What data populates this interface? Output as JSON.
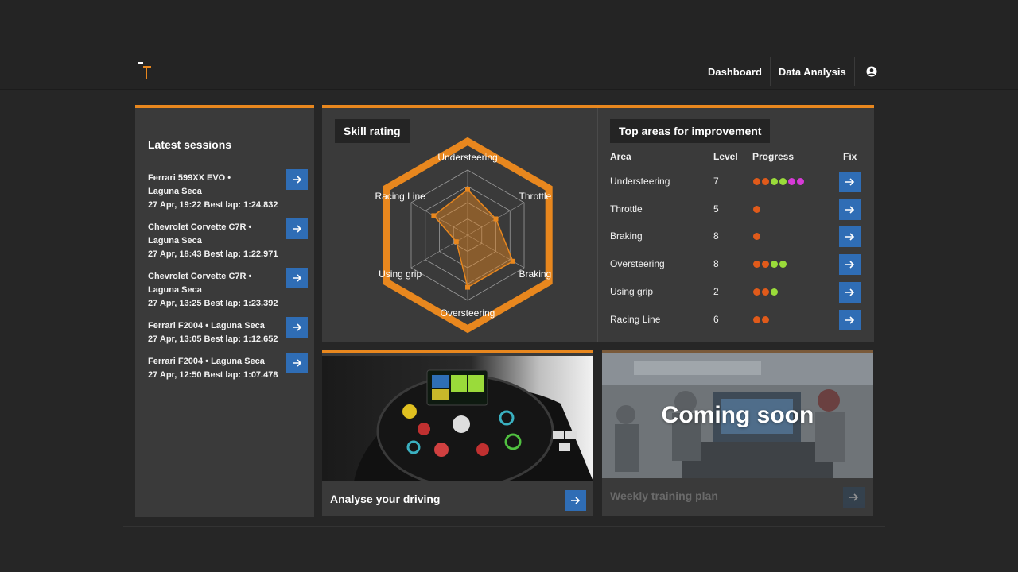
{
  "nav": {
    "dashboard": "Dashboard",
    "data_analysis": "Data Analysis",
    "user_icon": "user-circle-icon"
  },
  "colors": {
    "accent": "#e8871e",
    "button": "#2f6db5",
    "panel": "#3a3a3a",
    "background": "#262626"
  },
  "sessions": {
    "title": "Latest sessions",
    "items": [
      {
        "line1": "Ferrari 599XX EVO  •",
        "line2": "Laguna Seca",
        "line3": "27 Apr, 19:22 Best lap: 1:24.832"
      },
      {
        "line1": "Chevrolet Corvette C7R  •",
        "line2": "Laguna Seca",
        "line3": "27 Apr, 18:43 Best lap: 1:22.971"
      },
      {
        "line1": "Chevrolet Corvette C7R  •",
        "line2": "Laguna Seca",
        "line3": "27 Apr, 13:25 Best lap: 1:23.392"
      },
      {
        "line1": "Ferrari F2004  •  Laguna Seca",
        "line2": "27 Apr, 13:05 Best lap: 1:12.652"
      },
      {
        "line1": "Ferrari F2004  •  Laguna Seca",
        "line2": "27 Apr, 12:50 Best lap: 1:07.478"
      }
    ]
  },
  "skill": {
    "title": "Skill rating",
    "axes": [
      "Understeering",
      "Throttle",
      "Braking",
      "Oversteering",
      "Using grip",
      "Racing Line"
    ],
    "values": [
      7,
      5,
      8,
      8,
      2,
      6
    ],
    "max": 10
  },
  "improvement": {
    "title": "Top areas for improvement",
    "headers": {
      "area": "Area",
      "level": "Level",
      "progress": "Progress",
      "fix": "Fix"
    },
    "rows": [
      {
        "area": "Understeering",
        "level": "7",
        "progress": [
          "#e05a1a",
          "#e05a1a",
          "#9adb3a",
          "#9adb3a",
          "#d63ad6",
          "#d63ad6"
        ]
      },
      {
        "area": "Throttle",
        "level": "5",
        "progress": [
          "#e05a1a"
        ]
      },
      {
        "area": "Braking",
        "level": "8",
        "progress": [
          "#e05a1a"
        ]
      },
      {
        "area": "Oversteering",
        "level": "8",
        "progress": [
          "#e05a1a",
          "#e05a1a",
          "#9adb3a",
          "#9adb3a"
        ]
      },
      {
        "area": "Using grip",
        "level": "2",
        "progress": [
          "#e05a1a",
          "#e05a1a",
          "#9adb3a"
        ]
      },
      {
        "area": "Racing Line",
        "level": "6",
        "progress": [
          "#e05a1a",
          "#e05a1a"
        ]
      }
    ]
  },
  "cards": {
    "analyse": {
      "title": "Analyse your driving"
    },
    "weekly": {
      "title": "Weekly training plan",
      "overlay": "Coming soon"
    }
  }
}
